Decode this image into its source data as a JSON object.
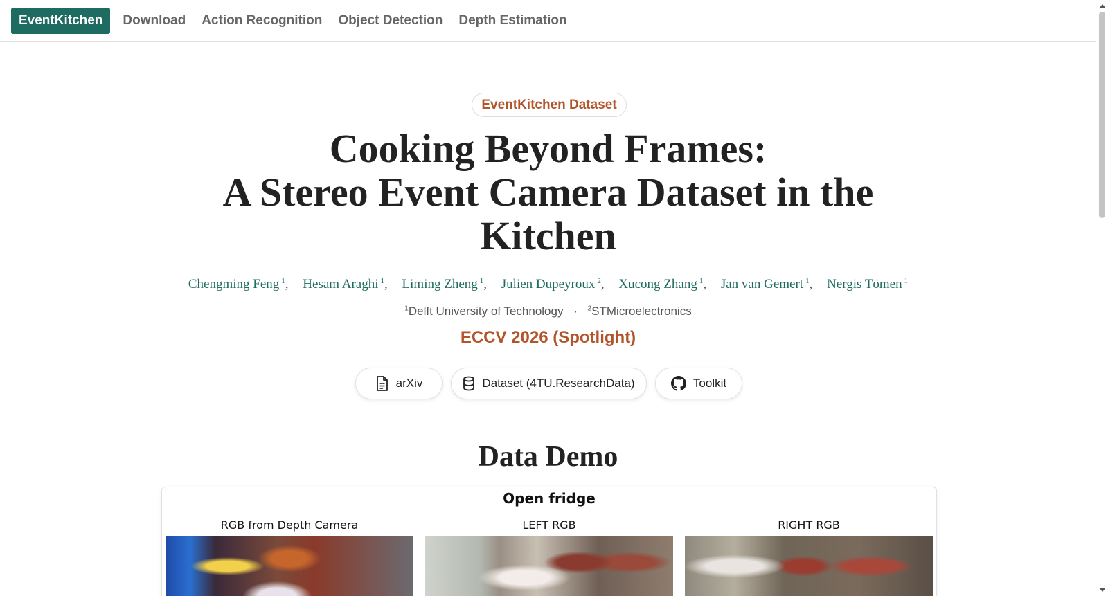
{
  "nav": {
    "brand": "EventKitchen",
    "links": [
      "Download",
      "Action Recognition",
      "Object Detection",
      "Depth Estimation"
    ]
  },
  "hero": {
    "pill": "EventKitchen Dataset",
    "title_line1": "Cooking Beyond Frames:",
    "title_line2": "A Stereo Event Camera Dataset in the",
    "title_line3": "Kitchen",
    "authors": [
      {
        "name": "Chengming Feng",
        "aff": "1"
      },
      {
        "name": "Hesam Araghi",
        "aff": "1"
      },
      {
        "name": "Liming Zheng",
        "aff": "1"
      },
      {
        "name": "Julien Dupeyroux",
        "aff": "2"
      },
      {
        "name": "Xucong Zhang",
        "aff": "1"
      },
      {
        "name": "Jan van Gemert",
        "aff": "1"
      },
      {
        "name": "Nergis Tömen",
        "aff": "1"
      }
    ],
    "affiliations": [
      {
        "num": "1",
        "name": "Delft University of Technology"
      },
      {
        "num": "2",
        "name": "STMicroelectronics"
      }
    ],
    "affil_sep": "·",
    "venue": "ECCV 2026 (Spotlight)",
    "buttons": {
      "arxiv": "arXiv",
      "dataset": "Dataset (4TU.ResearchData)",
      "toolkit": "Toolkit"
    }
  },
  "demo": {
    "section_title": "Data Demo",
    "clip_title": "Open fridge",
    "cameras": [
      "RGB from Depth Camera",
      "LEFT RGB",
      "RIGHT RGB"
    ]
  },
  "colors": {
    "brand": "#1e6b61",
    "accent": "#b3552a"
  }
}
